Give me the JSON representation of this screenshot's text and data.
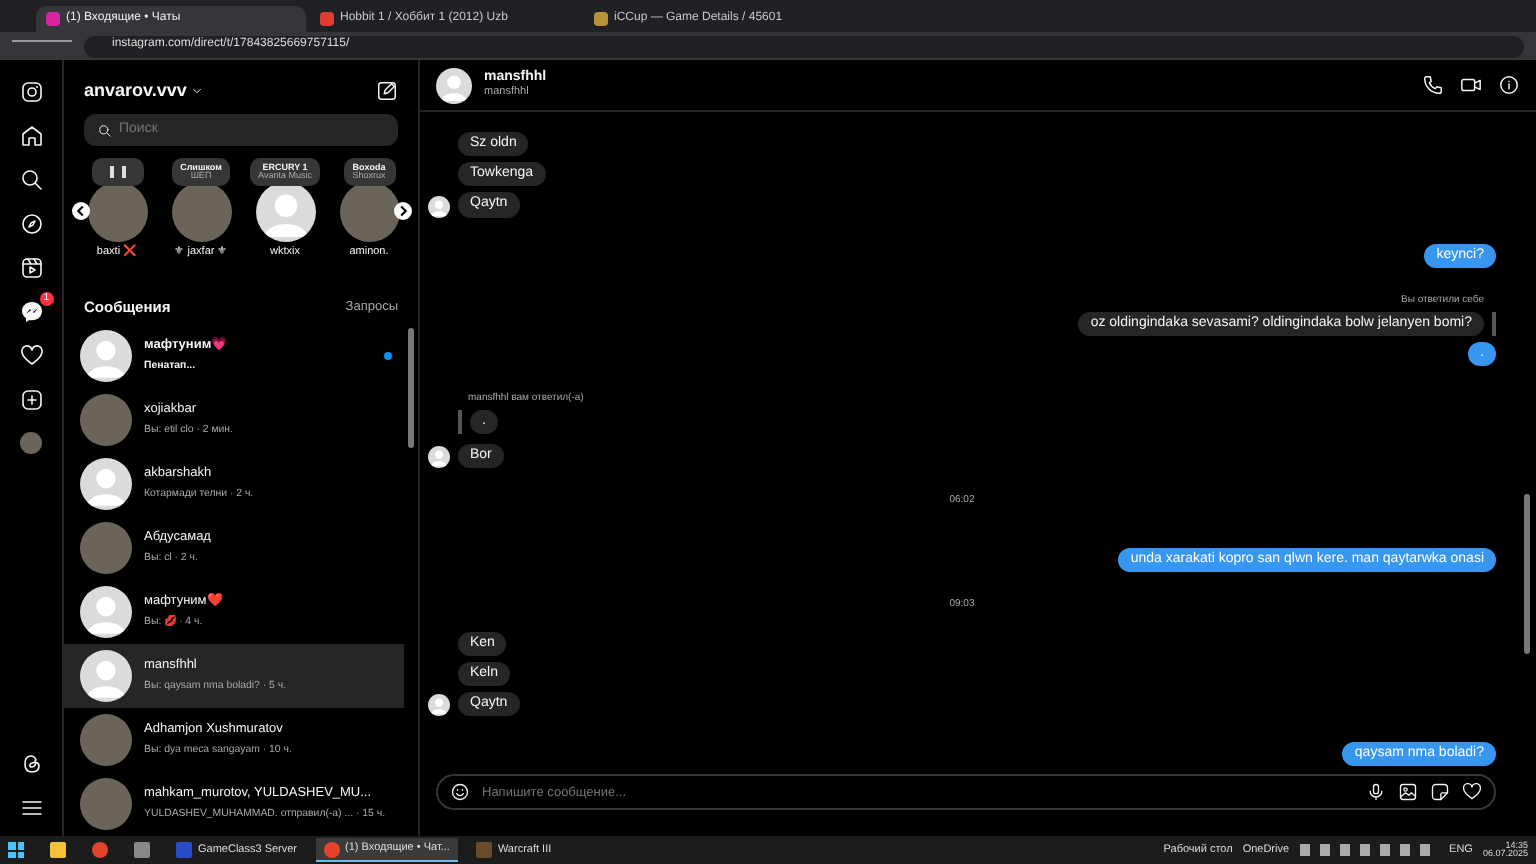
{
  "browser": {
    "tabs": [
      {
        "title": "(1) Входящие • Чаты",
        "selected": true
      },
      {
        "title": "Hobbit 1 / Хоббит 1 (2012) Uzb",
        "selected": false
      },
      {
        "title": "iCCup — Game Details / 45601",
        "selected": false
      }
    ],
    "address": "instagram.com/direct/t/17843825669757115/"
  },
  "rail": {
    "messages_badge": "1"
  },
  "inbox": {
    "account": "anvarov.vvv",
    "search": {
      "placeholder": "Поиск"
    },
    "notes": [
      {
        "kind": "paused",
        "name": "baxti ❌",
        "has_photo": true
      },
      {
        "kind": "music",
        "line1": "Слишком",
        "line2": "ШЕП",
        "name": "⚜ jaxfar ⚜",
        "has_photo": true
      },
      {
        "kind": "music",
        "line1": "ERCURY 1",
        "line2": "Avanta Music",
        "name": "wktxix",
        "has_photo": false
      },
      {
        "kind": "music",
        "line1": "Boxoda",
        "line2": "Shoxrux",
        "name": "aminon.",
        "has_photo": true
      }
    ],
    "section_title": "Сообщения",
    "requests": "Запросы",
    "threads": [
      {
        "name": "мафтуним💗",
        "preview": "Пенатап...",
        "unread": true,
        "selected": false,
        "has_photo": false
      },
      {
        "name": "xojiakbar",
        "preview": "Вы: etil clo · 2 мин.",
        "unread": false,
        "selected": false,
        "has_photo": true
      },
      {
        "name": "akbarshakh",
        "preview": "Котармади телни · 2 ч.",
        "unread": false,
        "selected": false,
        "has_photo": false
      },
      {
        "name": "Абдусамад",
        "preview": "Вы: cl · 2 ч.",
        "unread": false,
        "selected": false,
        "has_photo": true
      },
      {
        "name": "мафтуним❤️",
        "preview": "Вы: 💋 · 4 ч.",
        "unread": false,
        "selected": false,
        "has_photo": false
      },
      {
        "name": "mansfhhl",
        "preview": "Вы: qaysam nma boladi? · 5 ч.",
        "unread": false,
        "selected": true,
        "has_photo": false
      },
      {
        "name": "Adhamjon Xushmuratov",
        "preview": "Вы: dya meca sangayam · 10 ч.",
        "unread": false,
        "selected": false,
        "has_photo": true
      },
      {
        "name": "mahkam_murotov, YULDASHEV_MU...",
        "preview": "YULDASHEV_MUHAMMAD. отправил(-а) ... · 15 ч.",
        "unread": false,
        "selected": false,
        "has_photo": true
      }
    ]
  },
  "chat": {
    "name": "mansfhhl",
    "username": "mansfhhl",
    "messages": [
      {
        "kind": "in",
        "text": "Sz oldn",
        "avatar": false
      },
      {
        "kind": "in",
        "text": "Towkenga",
        "avatar": false
      },
      {
        "kind": "in",
        "text": "Qaytn",
        "avatar": true
      },
      {
        "kind": "out",
        "text": "keynci?"
      },
      {
        "kind": "note-out",
        "text": "Вы ответили себе"
      },
      {
        "kind": "quote-out",
        "text": "oz oldingindaka sevasami? oldingindaka bolw jelanyen bomi?"
      },
      {
        "kind": "out",
        "text": "."
      },
      {
        "kind": "note-in",
        "text": "mansfhhl вам ответил(-а)"
      },
      {
        "kind": "quote-in",
        "text": "."
      },
      {
        "kind": "in",
        "text": "Bor",
        "avatar": true
      },
      {
        "kind": "time",
        "text": "06:02"
      },
      {
        "kind": "out",
        "text": "unda xarakati kopro san qlwn kere.  man qaytarwka onasi"
      },
      {
        "kind": "time",
        "text": "09:03"
      },
      {
        "kind": "in",
        "text": "Ken",
        "avatar": false
      },
      {
        "kind": "in",
        "text": "Keln",
        "avatar": false
      },
      {
        "kind": "in",
        "text": "Qaytn",
        "avatar": true
      },
      {
        "kind": "out",
        "text": "qaysam nma boladi?"
      }
    ],
    "composer": {
      "placeholder": "Напишите сообщение..."
    }
  },
  "taskbar": {
    "apps": [
      {
        "label": "GameClass3 Server",
        "active": false
      },
      {
        "label": "(1) Входящие • Чат...",
        "active": true
      },
      {
        "label": "Warcraft III",
        "active": false
      }
    ],
    "desktop": "Рабочий стол",
    "onedrive": "OneDrive",
    "lang": "ENG",
    "time": "14:35",
    "date": "06.07.2025"
  }
}
